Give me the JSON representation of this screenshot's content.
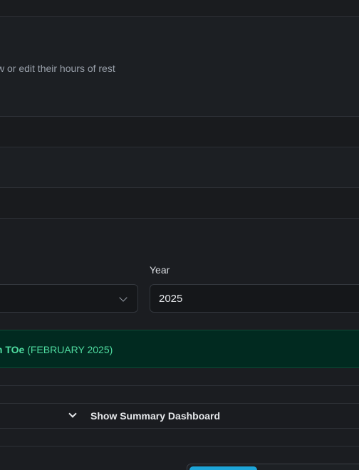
{
  "header": {
    "subtitle": "w or edit their hours of rest"
  },
  "filters": {
    "month_select": {
      "value": ""
    },
    "year": {
      "label": "Year",
      "value": "2025"
    }
  },
  "banner": {
    "name": "m TOe",
    "period": "(FEBRUARY 2025)"
  },
  "summary": {
    "toggle_label": "Show Summary Dashboard",
    "icon": "chevron-down-icon"
  },
  "colors": {
    "background": "#1b1d21",
    "banner_bg": "#012a20",
    "banner_text": "#4fdca0",
    "accent_button": "#1da5d8"
  }
}
